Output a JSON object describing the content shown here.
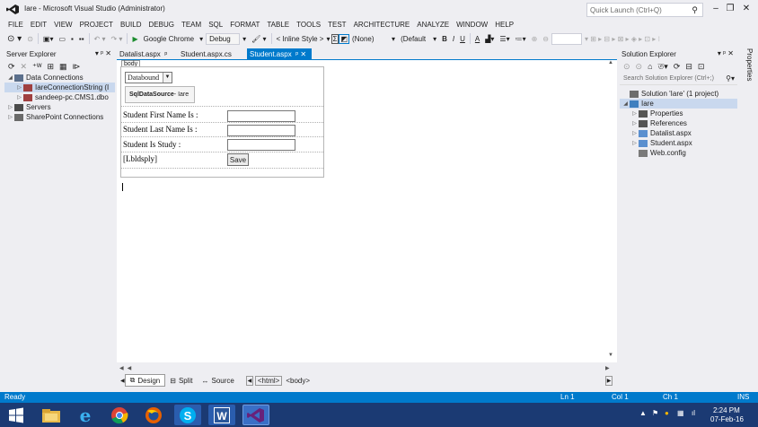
{
  "window": {
    "title": "Iare - Microsoft Visual Studio (Administrator)",
    "quick_launch_placeholder": "Quick Launch (Ctrl+Q)",
    "min_label": "–",
    "max_label": "❐",
    "close_label": "✕"
  },
  "menu": [
    "FILE",
    "EDIT",
    "VIEW",
    "PROJECT",
    "BUILD",
    "DEBUG",
    "TEAM",
    "SQL",
    "FORMAT",
    "TABLE",
    "TOOLS",
    "TEST",
    "ARCHITECTURE",
    "ANALYZE",
    "WINDOW",
    "HELP"
  ],
  "toolbar": {
    "browser_label": "Google Chrome",
    "config_label": "Debug",
    "style_label": "< Inline Style >",
    "css_class_label": "(None)",
    "font_label": "(Default",
    "bold": "B",
    "italic": "I",
    "underline": "U"
  },
  "server_explorer": {
    "title": "Server Explorer",
    "pin_label": "▾ ᵖ ✕",
    "items": [
      {
        "label": "Data Connections",
        "level": 0,
        "arrow": "◢",
        "selected": false
      },
      {
        "label": "IareConnectionString (I",
        "level": 1,
        "arrow": "▷",
        "selected": true
      },
      {
        "label": "sandeep-pc.CMS1.dbo",
        "level": 1,
        "arrow": "▷",
        "selected": false
      },
      {
        "label": "Servers",
        "level": 0,
        "arrow": "▷",
        "selected": false
      },
      {
        "label": "SharePoint Connections",
        "level": 0,
        "arrow": "▷",
        "selected": false
      }
    ]
  },
  "tabs": [
    {
      "label": "Datalist.aspx",
      "pin": "ᵖ",
      "active": false
    },
    {
      "label": "Student.aspx.cs",
      "pin": "",
      "active": false
    },
    {
      "label": "Student.aspx",
      "pin": "ᵖ ✕",
      "active": true
    }
  ],
  "designer": {
    "body_tag": "body",
    "dropdown_value": "Databound",
    "sqlds_name": "SqlDataSource",
    "sqlds_suffix": " - Iare",
    "fields": [
      {
        "label": "Student First Name Is :",
        "value": ""
      },
      {
        "label": "Student Last Name Is :",
        "value": ""
      },
      {
        "label": "Student Is Study :",
        "value": ""
      }
    ],
    "display_label": "[Lbldsply]",
    "save_button": "Save"
  },
  "view_bar": {
    "design": "Design",
    "split": "Split",
    "source": "Source",
    "crumbs": [
      "<html>",
      "<body>"
    ]
  },
  "solution_explorer": {
    "title": "Solution Explorer",
    "pin_label": "▾ ᵖ ✕",
    "search_placeholder": "Search Solution Explorer (Ctrl+;)",
    "items": [
      {
        "label": "Solution 'Iare' (1 project)",
        "level": 0,
        "arrow": "",
        "selected": false
      },
      {
        "label": "Iare",
        "level": 0,
        "arrow": "◢",
        "selected": true
      },
      {
        "label": "Properties",
        "level": 1,
        "arrow": "▷",
        "selected": false
      },
      {
        "label": "References",
        "level": 1,
        "arrow": "▷",
        "selected": false
      },
      {
        "label": "Datalist.aspx",
        "level": 1,
        "arrow": "▷",
        "selected": false
      },
      {
        "label": "Student.aspx",
        "level": 1,
        "arrow": "▷",
        "selected": false
      },
      {
        "label": "Web.config",
        "level": 1,
        "arrow": "",
        "selected": false
      }
    ]
  },
  "properties_tab": "Properties",
  "status": {
    "state": "Ready",
    "line": "Ln 1",
    "col": "Col 1",
    "ch": "Ch 1",
    "mode": "INS"
  },
  "taskbar": {
    "time": "2:24 PM",
    "date": "07-Feb-16",
    "apps": [
      "explorer-icon",
      "ie-icon",
      "chrome-icon",
      "firefox-icon",
      "skype-icon",
      "word-icon",
      "visual-studio-icon"
    ]
  },
  "colors": {
    "accent": "#007acc",
    "chrome_bg": "#eeeef2",
    "taskbar": "#1b3a73",
    "vs_purple": "#68217a"
  }
}
